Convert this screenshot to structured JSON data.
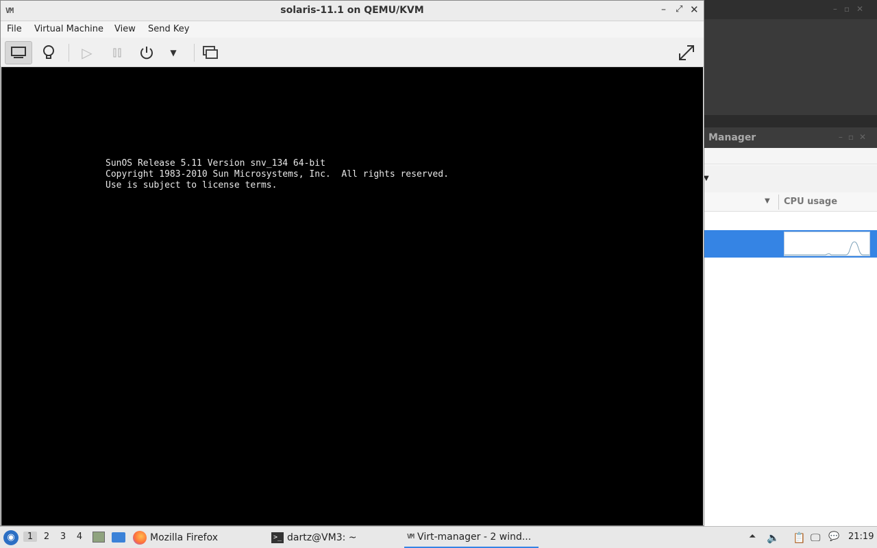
{
  "vm_window": {
    "title": "solaris-11.1 on QEMU/KVM",
    "app_icon": "VM",
    "menu": [
      "File",
      "Virtual Machine",
      "View",
      "Send Key"
    ],
    "toolbar": {
      "console_icon": "monitor-icon",
      "details_icon": "lightbulb-icon",
      "run_icon": "play-icon",
      "pause_icon": "pause-icon",
      "power_icon": "power-icon",
      "power_menu_icon": "chevron-down-icon",
      "snapshots_icon": "snapshots-icon",
      "fullscreen_icon": "fullscreen-icon"
    },
    "console_lines": [
      "SunOS Release 5.11 Version snv_134 64-bit",
      "Copyright 1983-2010 Sun Microsystems, Inc.  All rights reserved.",
      "Use is subject to license terms."
    ]
  },
  "background_manager": {
    "title": "Manager",
    "column_cpu": "CPU usage"
  },
  "taskbar": {
    "workspaces": [
      "1",
      "2",
      "3",
      "4"
    ],
    "tasks": {
      "firefox": "Mozilla Firefox",
      "terminal": "dartz@VM3: ~",
      "virt_manager": "Virt-manager - 2 wind..."
    },
    "clock": "21:19"
  },
  "colors": {
    "console_bg": "#000000",
    "console_text": "#e8e8e8",
    "selection": "#3584e4"
  }
}
